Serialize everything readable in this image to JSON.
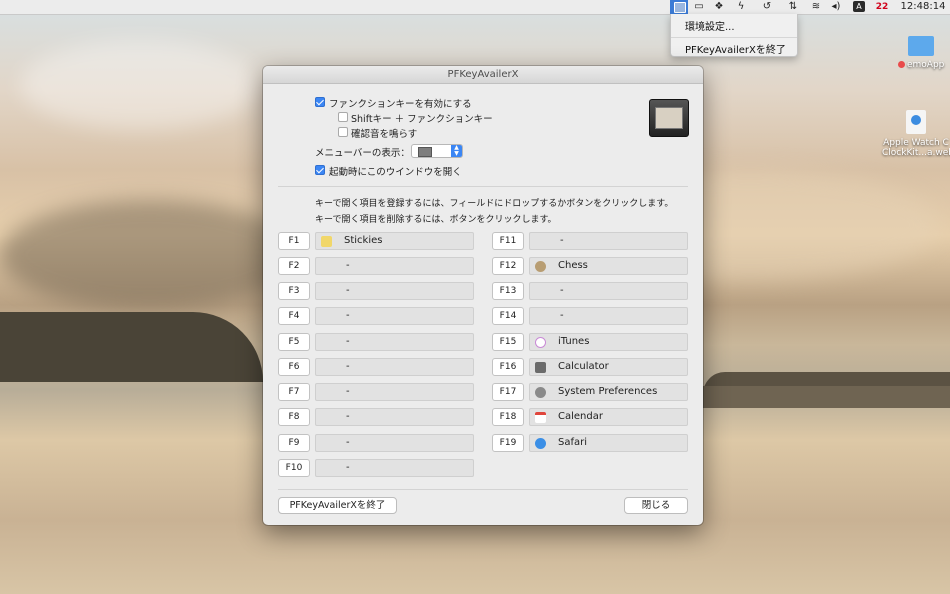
{
  "menubar": {
    "clock": "12:48:14",
    "date_day": "22",
    "input_indicator": "A",
    "icons": [
      "pfkey-menubar-icon",
      "clipboard-icon",
      "dropbox-icon",
      "bolt-icon",
      "time-machine-icon",
      "network-icon",
      "wifi-icon",
      "volume-icon",
      "input-source-icon",
      "calendar-date-icon"
    ]
  },
  "menu": {
    "items": [
      {
        "label": "環境設定..."
      },
      {
        "label": "PFKeyAvailerXを終了"
      }
    ]
  },
  "desktop": {
    "items": [
      {
        "label": "emoApp"
      },
      {
        "label": "Apple Watch C ClockKit...a.webloc"
      }
    ]
  },
  "window": {
    "title": "PFKeyAvailerX",
    "options": {
      "enable_fkeys": {
        "label": "ファンクションキーを有効にする",
        "checked": true
      },
      "shift_fkeys": {
        "label": "Shiftキー ＋ ファンクションキー",
        "checked": false
      },
      "beep": {
        "label": "確認音を鳴らす",
        "checked": false
      },
      "menubar_display_label": "メニューバーの表示：",
      "open_window_on_launch": {
        "label": "起動時にこのウインドウを開く",
        "checked": true
      }
    },
    "info_lines": [
      "キーで開く項目を登録するには、フィールドにドロップするかボタンをクリックします。",
      "キーで開く項目を削除するには、ボタンをクリックします。"
    ],
    "left_keys": [
      {
        "key": "F1",
        "app": "Stickies",
        "icon": "stickies-icon"
      },
      {
        "key": "F2",
        "app": "-"
      },
      {
        "key": "F3",
        "app": "-"
      },
      {
        "key": "F4",
        "app": "-"
      },
      {
        "key": "F5",
        "app": "-"
      },
      {
        "key": "F6",
        "app": "-"
      },
      {
        "key": "F7",
        "app": "-"
      },
      {
        "key": "F8",
        "app": "-"
      },
      {
        "key": "F9",
        "app": "-"
      },
      {
        "key": "F10",
        "app": "-"
      }
    ],
    "right_keys": [
      {
        "key": "F11",
        "app": "-"
      },
      {
        "key": "F12",
        "app": "Chess",
        "icon": "chess-icon"
      },
      {
        "key": "F13",
        "app": "-"
      },
      {
        "key": "F14",
        "app": "-"
      },
      {
        "key": "F15",
        "app": "iTunes",
        "icon": "itunes-icon"
      },
      {
        "key": "F16",
        "app": "Calculator",
        "icon": "calculator-icon"
      },
      {
        "key": "F17",
        "app": "System Preferences",
        "icon": "system-preferences-icon"
      },
      {
        "key": "F18",
        "app": "Calendar",
        "icon": "calendar-icon"
      },
      {
        "key": "F19",
        "app": "Safari",
        "icon": "safari-icon"
      }
    ],
    "quit_button": "PFKeyAvailerXを終了",
    "close_button": "閉じる"
  },
  "colors": {
    "accent": "#3b86f4",
    "menubar_active": "#3b7bd6",
    "date_red": "#d0021b"
  }
}
